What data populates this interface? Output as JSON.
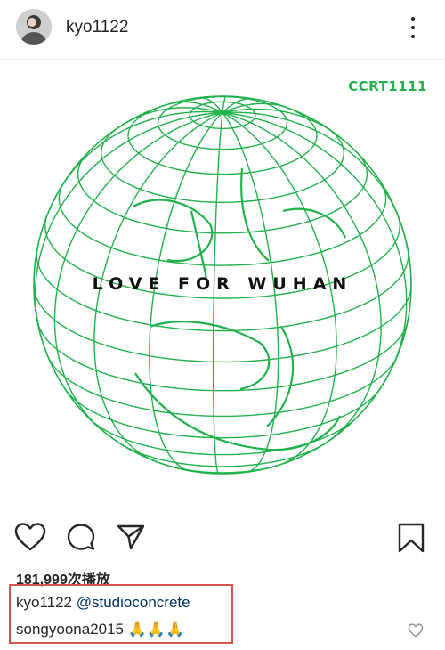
{
  "header": {
    "username": "kyo1122"
  },
  "post": {
    "brand_mark": "CCRT1111",
    "headline": "LOVE FOR WUHAN",
    "accent_color": "#22b14c"
  },
  "stats": {
    "views": "181,999次播放"
  },
  "caption": {
    "username": "kyo1122",
    "mention": "@studioconcrete"
  },
  "comment": {
    "username": "songyoona2015",
    "emojis": "🙏🙏🙏"
  },
  "icons": [
    "more-options-icon",
    "heart-icon",
    "comment-icon",
    "share-icon",
    "bookmark-icon",
    "small-heart-icon"
  ]
}
